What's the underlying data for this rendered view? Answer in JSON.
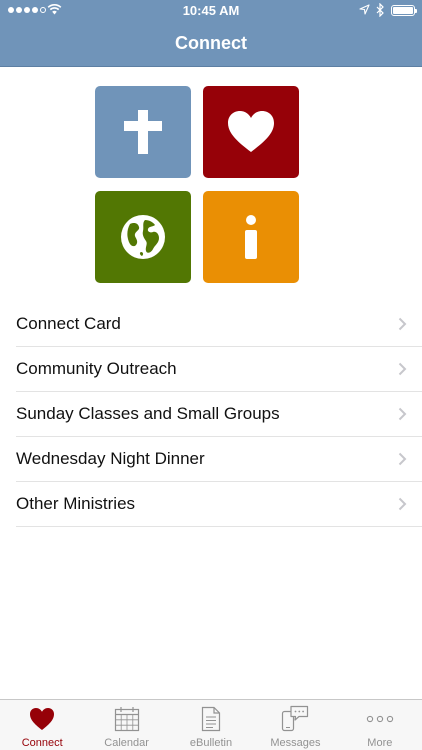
{
  "status_bar": {
    "time": "10:45 AM",
    "signal_icon": "cellular-signal-icon",
    "wifi_icon": "wifi-icon",
    "location_icon": "location-arrow-icon",
    "bluetooth_icon": "bluetooth-icon",
    "battery_icon": "battery-icon",
    "battery_level": 1.0
  },
  "nav": {
    "title": "Connect"
  },
  "tiles": [
    {
      "icon": "cross-icon",
      "color": "#7094b9"
    },
    {
      "icon": "heart-icon",
      "color": "#960108"
    },
    {
      "icon": "globe-icon",
      "color": "#527703"
    },
    {
      "icon": "info-icon",
      "color": "#ea8f04"
    }
  ],
  "menu": {
    "items": [
      {
        "label": "Connect Card"
      },
      {
        "label": "Community Outreach"
      },
      {
        "label": "Sunday Classes and Small Groups"
      },
      {
        "label": "Wednesday Night Dinner"
      },
      {
        "label": "Other Ministries"
      }
    ]
  },
  "tab_bar": {
    "tabs": [
      {
        "label": "Connect",
        "icon": "heart-icon",
        "active": true
      },
      {
        "label": "Calendar",
        "icon": "calendar-icon",
        "active": false
      },
      {
        "label": "eBulletin",
        "icon": "document-icon",
        "active": false
      },
      {
        "label": "Messages",
        "icon": "messages-icon",
        "active": false
      },
      {
        "label": "More",
        "icon": "more-icon",
        "active": false
      }
    ]
  },
  "colors": {
    "nav_background": "#7094b9",
    "accent": "#960108",
    "tab_inactive": "#929292"
  }
}
